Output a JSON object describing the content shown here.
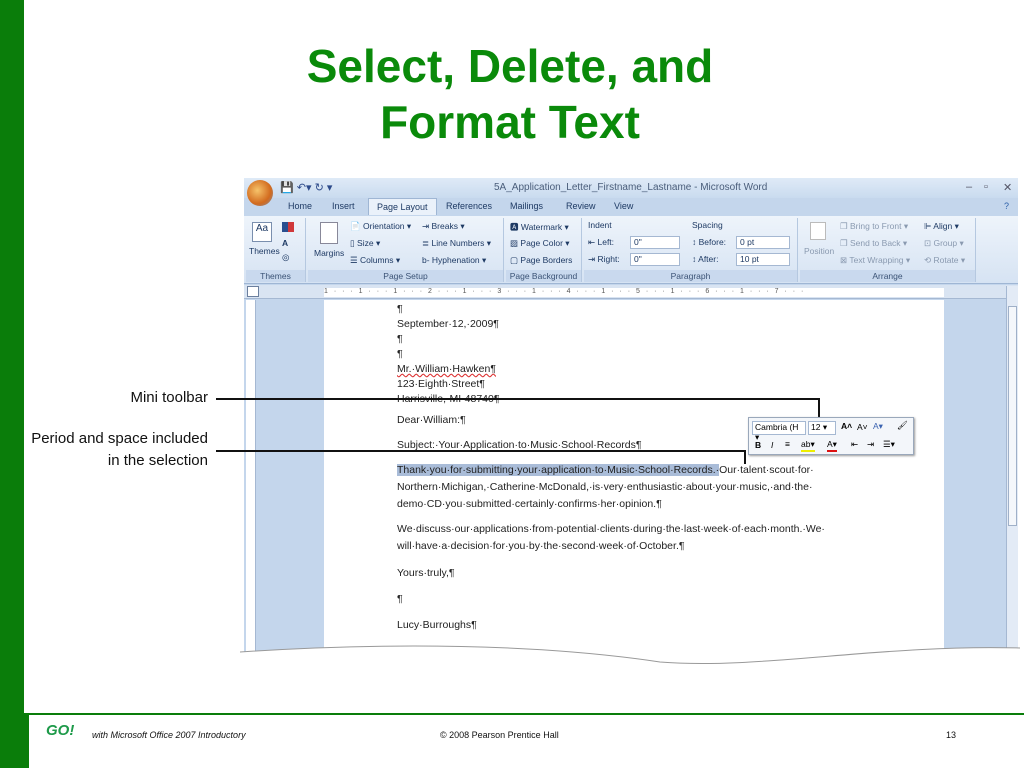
{
  "slide": {
    "title_line1": "Select, Delete, and",
    "title_line2": "Format Text",
    "footer_logo": "GO!",
    "footer_text": "with Microsoft Office 2007 Introductory",
    "copyright": "© 2008 Pearson Prentice Hall",
    "page_number": "13"
  },
  "callouts": {
    "mini_toolbar": "Mini toolbar",
    "period_line1": "Period and space included",
    "period_line2": "in the selection"
  },
  "word": {
    "window_title": "5A_Application_Letter_Firstname_Lastname - Microsoft Word",
    "tabs": [
      "Home",
      "Insert",
      "Page Layout",
      "References",
      "Mailings",
      "Review",
      "View"
    ],
    "ribbon": {
      "themes": {
        "label": "Themes",
        "group": "Themes"
      },
      "page_setup": {
        "margins": "Margins",
        "orientation": "Orientation",
        "size": "Size",
        "columns": "Columns",
        "breaks": "Breaks",
        "line_numbers": "Line Numbers",
        "hyphenation": "Hyphenation",
        "group": "Page Setup"
      },
      "page_background": {
        "watermark": "Watermark",
        "page_color": "Page Color",
        "page_borders": "Page Borders",
        "group": "Page Background"
      },
      "paragraph": {
        "indent": "Indent",
        "left_label": "Left:",
        "left_value": "0\"",
        "right_label": "Right:",
        "right_value": "0\"",
        "spacing": "Spacing",
        "before_label": "Before:",
        "before_value": "0 pt",
        "after_label": "After:",
        "after_value": "10 pt",
        "group": "Paragraph"
      },
      "arrange": {
        "position": "Position",
        "bring_to_front": "Bring to Front",
        "send_to_back": "Send to Back",
        "text_wrapping": "Text Wrapping",
        "align": "Align",
        "group_btn": "Group",
        "rotate": "Rotate",
        "group": "Arrange"
      }
    },
    "ruler": "1 · · · 1 · · · 1 · · · 2 · · · 1 · · · 3 · · · 1 · · · 4 · · · 1 · · · 5 · · · 1 · · · 6 · · · 1 · · · 7 · · ·",
    "mini_toolbar": {
      "font": "Cambria (H",
      "size": "12",
      "bold": "B",
      "italic": "I"
    },
    "document": {
      "l1": "¶",
      "date": "September·12,·2009¶",
      "l3": "¶",
      "l4": "¶",
      "name": "Mr.·William·Hawken¶",
      "street": "123·Eighth·Street¶",
      "city": "Harrisville,·MI·48740¶",
      "salutation": "Dear·William:¶",
      "subject": "Subject:·Your·Application·to·Music·School·Records¶",
      "p1_selected": "Thank·you·for·submitting·your·application·to·Music·School·Records.·",
      "p1_rest": "Our·talent·scout·for·",
      "p1_l2": "Northern·Michigan,·Catherine·McDonald,·is·very·enthusiastic·about·your·music,·and·the·",
      "p1_l3": "demo·CD·you·submitted·certainly·confirms·her·opinion.¶",
      "p2_l1": "We·discuss·our·applications·from·potential·clients·during·the·last·week·of·each·month.·We·",
      "p2_l2": "will·have·a·decision·for·you·by·the·second·week·of·October.¶",
      "closing": "Yours·truly,¶",
      "blank": "¶",
      "signature": "Lucy·Burroughs¶"
    }
  }
}
